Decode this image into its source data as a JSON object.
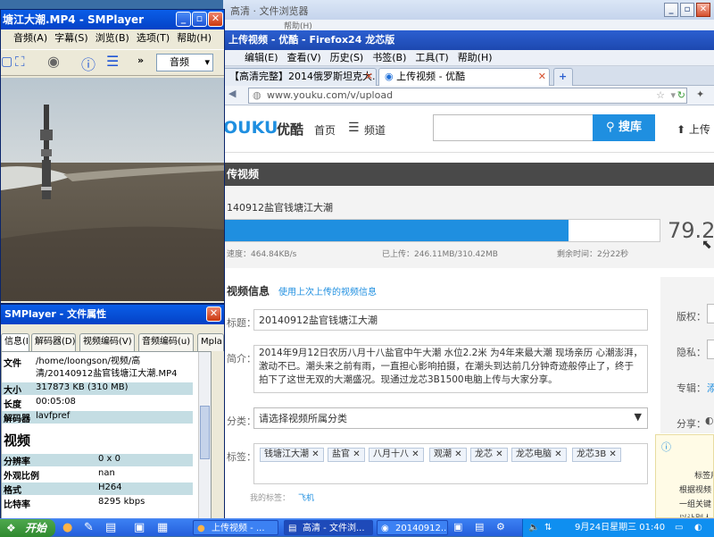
{
  "background_window": {
    "title": "高清 · 文件浏览器",
    "menu_help": "帮助(H)"
  },
  "firefox": {
    "title": "上传视频 - 优酷 - Firefox24 龙芯版",
    "menu": [
      "编辑(E)",
      "查看(V)",
      "历史(S)",
      "书签(B)",
      "工具(T)",
      "帮助(H)"
    ],
    "tabs": [
      {
        "label": "【高清完整】2014俄罗斯坦克大..."
      },
      {
        "label": "上传视频 - 优酷"
      }
    ],
    "url": "www.youku.com/v/upload",
    "youku": {
      "logo_text": "OUKU",
      "logo_cn": "优酷",
      "nav_home": "首页",
      "nav_channel": "频道",
      "search_button": "搜库",
      "upload_link": "上传",
      "section_title": "传视频",
      "filename": "140912盐官钱塘江大潮",
      "progress_percent": "79.2",
      "progress_fraction": 0.792,
      "speed": "速度：464.84KB/s",
      "uploaded": "已上传：246.11MB/310.42MB",
      "remaining": "剩余时间：2分22秒",
      "info_heading": "视频信息",
      "use_last_info": "使用上次上传的视频信息",
      "title_label": "标题：",
      "title_value": "20140912盐官钱塘江大潮",
      "desc_label": "简介：",
      "desc_value": "2014年9月12日农历八月十八盐官中午大潮 水位2.2米 为4年来最大潮 现场亲历 心潮澎湃，激动不已。潮头来之前有雨，一直担心影响拍摄，在潮头到达前几分钟奇迹般停止了，终于拍下了这世无双的大潮盛况。现通过龙芯3B1500电脑上传与大家分享。",
      "category_label": "分类：",
      "category_value": "请选择视频所属分类",
      "tags_label": "标签：",
      "tags": [
        "钱塘江大潮",
        "盐官",
        "八月十八",
        "观潮",
        "龙芯",
        "龙芯电脑",
        "龙芯3B"
      ],
      "my_tags": "我的标签：",
      "my_tags_link": "飞机",
      "copyright_label": "版权：",
      "privacy_label": "隐私：",
      "album_label": "专辑：",
      "album_link": "添",
      "share_label": "分享：",
      "tag_tip": "标签用空\n根据视频\n一组关键\n以让别人"
    }
  },
  "smplayer": {
    "title": "塘江大潮.MP4 - SMPlayer",
    "menu": [
      "音频(A)",
      "字幕(S)",
      "浏览(B)",
      "选项(T)",
      "帮助(H)"
    ],
    "audio_dropdown": "音频"
  },
  "properties": {
    "title": "SMPlayer - 文件属性",
    "tabs": [
      "信息(I)",
      "解码器(D)",
      "视频编码(V)",
      "音频编码(u)",
      "Mpla"
    ],
    "file_label": "文件",
    "file_value": "/home/loongson/视频/高清/20140912盐官钱塘江大潮.MP4",
    "rows": [
      {
        "k": "大小",
        "v": "317873 KB (310 MB)"
      },
      {
        "k": "长度",
        "v": "00:05:08"
      },
      {
        "k": "解码器",
        "v": "lavfpref"
      }
    ],
    "video_heading": "视频",
    "video_rows": [
      {
        "k": "分辨率",
        "v": "0 x 0"
      },
      {
        "k": "外观比例",
        "v": "nan"
      },
      {
        "k": "格式",
        "v": "H264"
      },
      {
        "k": "比特率",
        "v": "8295 kbps"
      }
    ]
  },
  "taskbar": {
    "start": "开始",
    "tasks": [
      "上传视频 - ...",
      "高清 - 文件浏...",
      "20140912..."
    ],
    "clock": "9月24日星期三 01:40"
  }
}
